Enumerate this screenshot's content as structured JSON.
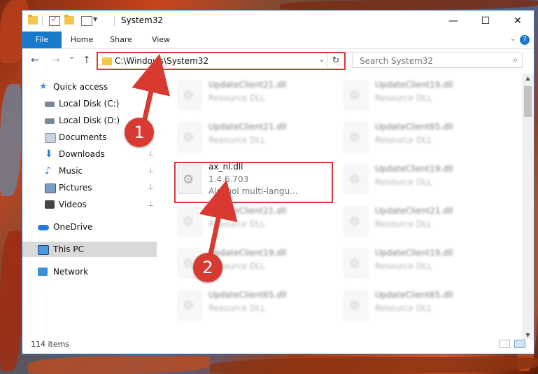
{
  "window": {
    "title": "System32",
    "controls": {
      "minimize": "—",
      "maximize": "☐",
      "close": "✕"
    }
  },
  "ribbon": {
    "tabs": [
      "File",
      "Home",
      "Share",
      "View"
    ],
    "help": "?"
  },
  "nav": {
    "back": "←",
    "forward": "→",
    "recent": "⌄",
    "up": "↑",
    "address": "C:\\Windows\\System32",
    "address_dropdown": "⌄",
    "refresh": "↻",
    "search_placeholder": "Search System32",
    "search_icon": "⌕"
  },
  "sidebar": {
    "items": [
      {
        "label": "Quick access",
        "icon": "star-icon",
        "color": "#3b8ee8",
        "pin": ""
      },
      {
        "label": "Local Disk (C:)",
        "icon": "drive-icon",
        "color": "#7b8794",
        "pin": ""
      },
      {
        "label": "Local Disk (D:)",
        "icon": "drive-icon",
        "color": "#7b8794",
        "pin": ""
      },
      {
        "label": "Documents",
        "icon": "documents-icon",
        "color": "#c9d3de",
        "pin": ""
      },
      {
        "label": "Downloads",
        "icon": "downloads-icon",
        "color": "#2a78d6",
        "pin": "📌"
      },
      {
        "label": "Music",
        "icon": "music-icon",
        "color": "#2a78d6",
        "pin": "📌"
      },
      {
        "label": "Pictures",
        "icon": "pictures-icon",
        "color": "#7a9ec6",
        "pin": "📌"
      },
      {
        "label": "Videos",
        "icon": "videos-icon",
        "color": "#444",
        "pin": "📌"
      },
      {
        "label": "OneDrive",
        "icon": "onedrive-icon",
        "color": "#2a78d6",
        "pin": ""
      },
      {
        "label": "This PC",
        "icon": "pc-icon",
        "color": "#4a9ae0",
        "pin": ""
      },
      {
        "label": "Network",
        "icon": "network-icon",
        "color": "#3c8fd8",
        "pin": ""
      }
    ]
  },
  "files": {
    "left": [
      {
        "name": "UpdateClient21.dll",
        "sub": "Resource DLL"
      },
      {
        "name": "UpdateClient21.dll",
        "sub": "Resource DLL"
      },
      {
        "name": "ax_nl.dll",
        "sub": "1.4.6.703",
        "sub2": "Alcohol multi-langu..."
      },
      {
        "name": "UpdateClient21.dll",
        "sub": "Resource DLL"
      },
      {
        "name": "UpdateClient19.dll",
        "sub": "Resource DLL"
      },
      {
        "name": "UpdateClient65.dll",
        "sub": "Resource DLL"
      }
    ],
    "right": [
      {
        "name": "UpdateClient19.dll",
        "sub": "Resource DLL"
      },
      {
        "name": "UpdateClient65.dll",
        "sub": "Resource DLL"
      },
      {
        "name": "UpdateClient19.dll",
        "sub": "Resource DLL"
      },
      {
        "name": "UpdateClient21.dll",
        "sub": "Resource DLL"
      },
      {
        "name": "UpdateClient19.dll",
        "sub": "Resource DLL"
      },
      {
        "name": "UpdateClient65.dll",
        "sub": "Resource DLL"
      }
    ]
  },
  "status": {
    "count": "114 items"
  },
  "callouts": [
    "1",
    "2"
  ],
  "colors": {
    "accent": "#1979ca",
    "highlight": "#d9383a",
    "callout": "#d83a32"
  }
}
